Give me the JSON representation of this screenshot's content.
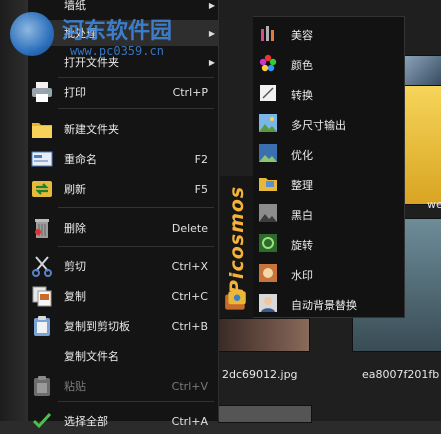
{
  "watermark": {
    "site_name": "河东软件园",
    "url": "www.pc0359.cn"
  },
  "menu": {
    "items": [
      {
        "label": "墙纸",
        "shortcut": "",
        "submenu": true
      },
      {
        "label": "批处理",
        "shortcut": "",
        "submenu": true
      },
      {
        "label": "打开文件夹",
        "shortcut": "",
        "submenu": true
      },
      {
        "label": "打印",
        "shortcut": "Ctrl+P"
      },
      {
        "label": "新建文件夹",
        "shortcut": ""
      },
      {
        "label": "重命名",
        "shortcut": "F2"
      },
      {
        "label": "刷新",
        "shortcut": "F5"
      },
      {
        "label": "删除",
        "shortcut": "Delete"
      },
      {
        "label": "剪切",
        "shortcut": "Ctrl+X"
      },
      {
        "label": "复制",
        "shortcut": "Ctrl+C"
      },
      {
        "label": "复制到剪切板",
        "shortcut": "Ctrl+B"
      },
      {
        "label": "复制文件名",
        "shortcut": ""
      },
      {
        "label": "粘贴",
        "shortcut": "Ctrl+V",
        "disabled": true
      },
      {
        "label": "选择全部",
        "shortcut": "Ctrl+A"
      }
    ]
  },
  "submenu": {
    "brand": "Picosmos",
    "items": [
      {
        "label": "美容"
      },
      {
        "label": "颜色"
      },
      {
        "label": "转换"
      },
      {
        "label": "多尺寸输出"
      },
      {
        "label": "优化"
      },
      {
        "label": "整理"
      },
      {
        "label": "黑白"
      },
      {
        "label": "旋转"
      },
      {
        "label": "水印"
      },
      {
        "label": "自动背景替换"
      }
    ]
  },
  "background": {
    "file_labels": [
      "2dc69012.jpg",
      "ea8007f201fb",
      "we"
    ]
  },
  "colors": {
    "accent": "#f4b23a",
    "menu_bg": "#141414",
    "watermark": "#3f8be6"
  }
}
